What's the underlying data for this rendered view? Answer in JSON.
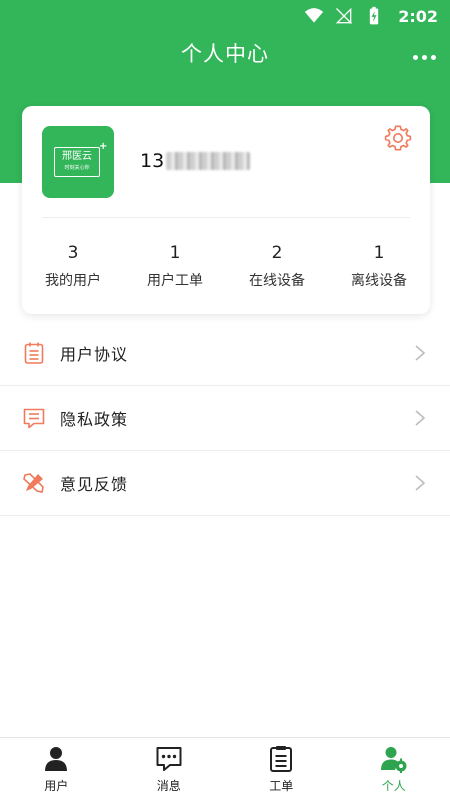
{
  "status_bar": {
    "time": "2:02"
  },
  "header": {
    "title": "个人中心"
  },
  "profile": {
    "logo_main": "邢医云",
    "logo_sub": "时刻关心你",
    "phone_prefix": "13",
    "stats": [
      {
        "value": "3",
        "label": "我的用户"
      },
      {
        "value": "1",
        "label": "用户工单"
      },
      {
        "value": "2",
        "label": "在线设备"
      },
      {
        "value": "1",
        "label": "离线设备"
      }
    ]
  },
  "menu": [
    {
      "label": "用户协议",
      "icon": "clipboard-icon"
    },
    {
      "label": "隐私政策",
      "icon": "message-icon"
    },
    {
      "label": "意见反馈",
      "icon": "edit-tools-icon"
    }
  ],
  "tabbar": [
    {
      "label": "用户",
      "icon": "person-icon"
    },
    {
      "label": "消息",
      "icon": "chat-icon"
    },
    {
      "label": "工单",
      "icon": "clipboard-icon"
    },
    {
      "label": "个人",
      "icon": "person-gear-icon",
      "active": true
    }
  ],
  "colors": {
    "primary": "#33b55a",
    "accent": "#f07a5c",
    "active_tab": "#2ea44f"
  }
}
